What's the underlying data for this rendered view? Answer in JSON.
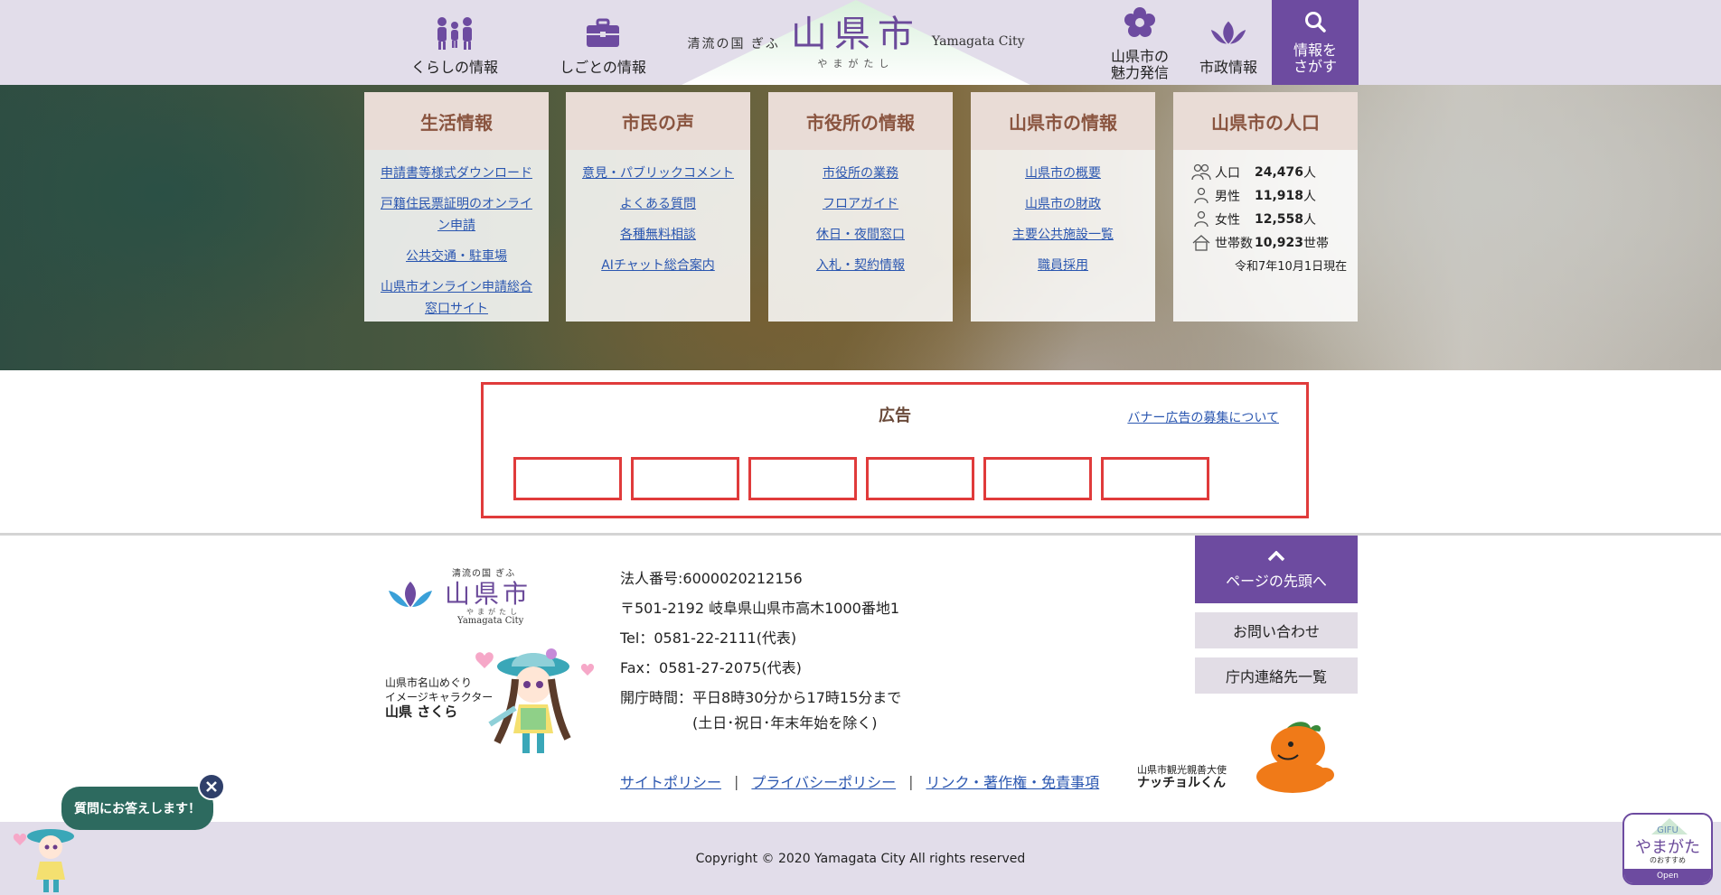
{
  "header": {
    "nav_left": [
      {
        "label": "くらしの情報",
        "icon": "people-icon"
      },
      {
        "label": "しごとの情報",
        "icon": "briefcase-icon"
      }
    ],
    "logo": {
      "tagline": "清流の国 ぎふ",
      "name": "山県市",
      "kana": "やまがたし",
      "english": "Yamagata City"
    },
    "nav_right": [
      {
        "label_line1": "山県市の",
        "label_line2": "魅力発信",
        "icon": "flower-icon"
      },
      {
        "label_line1": "市政情報",
        "label_line2": "",
        "icon": "city-emblem-icon"
      }
    ],
    "search": {
      "line1": "情報を",
      "line2": "さがす",
      "icon": "search-icon"
    }
  },
  "cards": [
    {
      "title": "生活情報",
      "links": [
        "申請書等様式ダウンロード",
        "戸籍住民票証明のオンライン申請",
        "公共交通・駐車場",
        "山県市オンライン申請総合窓口サイト"
      ]
    },
    {
      "title": "市民の声",
      "links": [
        "意見・パブリックコメント",
        "よくある質問",
        "各種無料相談",
        "AIチャット総合案内"
      ]
    },
    {
      "title": "市役所の情報",
      "links": [
        "市役所の業務",
        "フロアガイド",
        "休日・夜間窓口",
        "入札・契約情報"
      ]
    },
    {
      "title": "山県市の情報",
      "links": [
        "山県市の概要",
        "山県市の財政",
        "主要公共施設一覧",
        "職員採用"
      ]
    }
  ],
  "population": {
    "title": "山県市の人口",
    "rows": [
      {
        "label": "人口",
        "value": "24,476",
        "unit": "人"
      },
      {
        "label": "男性",
        "value": "11,918",
        "unit": "人"
      },
      {
        "label": "女性",
        "value": "12,558",
        "unit": "人"
      },
      {
        "label": "世帯数",
        "value": "10,923",
        "unit": "世帯"
      }
    ],
    "date": "令和7年10月1日現在"
  },
  "ad": {
    "title": "広告",
    "link": "バナー広告の募集について"
  },
  "footer": {
    "logo": {
      "tagline": "清流の国 ぎふ",
      "name": "山県市",
      "kana": "やまがたし",
      "english": "Yamagata City"
    },
    "character_caption": {
      "line1": "山県市名山めぐり",
      "line2": "イメージキャラクター",
      "name": "山県 さくら"
    },
    "corp_number": "法人番号:6000020212156",
    "address": "〒501-2192 岐阜県山県市高木1000番地1",
    "tel": "Tel：0581-22-2111(代表)",
    "fax": "Fax：0581-27-2075(代表)",
    "hours": "開庁時間：平日8時30分から17時15分まで",
    "hours_note": "(土日･祝日･年末年始を除く)",
    "links": [
      "サイトポリシー",
      "プライバシーポリシー",
      "リンク・著作権・免責事項"
    ],
    "page_top": "ページの先頭へ",
    "contact": "お問い合わせ",
    "directory": "庁内連絡先一覧",
    "ambassador_caption": {
      "line1": "山県市観光親善大使",
      "name": "ナッチョルくん"
    },
    "copyright": "Copyright © 2020 Yamagata City All rights reserved"
  },
  "chat": {
    "bubble": "質問にお答えします！"
  },
  "gifu_badge": {
    "line1": "GIFU",
    "line2": "やまがた",
    "line3": "のおすすめ",
    "open": "Open"
  },
  "colors": {
    "brand_purple": "#6d4ba0",
    "header_bg": "#e2ddea",
    "card_head": "#e9dcd6",
    "ad_border": "#e03b3b",
    "link": "#2a56b0"
  }
}
